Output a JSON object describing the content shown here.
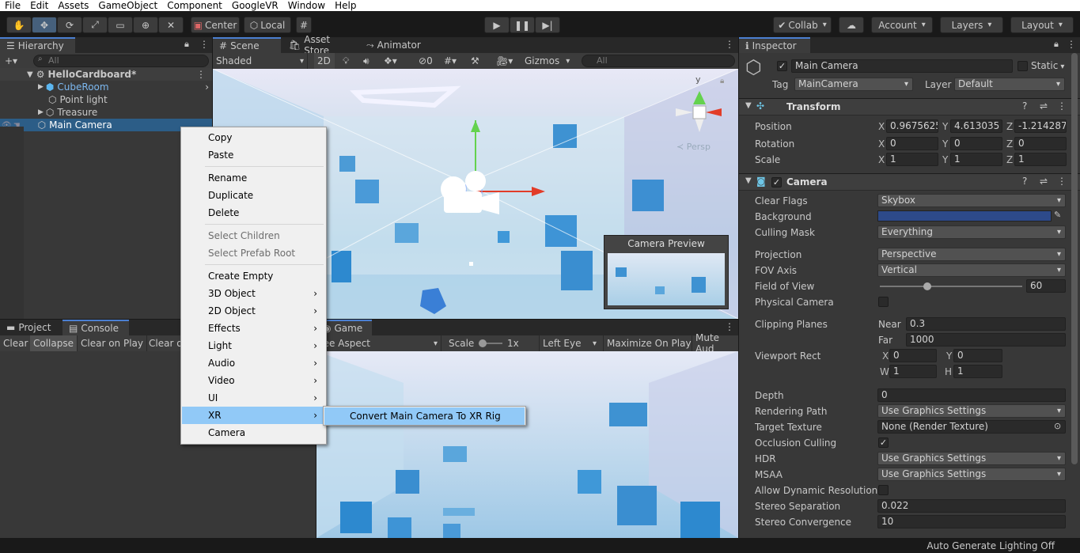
{
  "menubar": [
    "File",
    "Edit",
    "Assets",
    "GameObject",
    "Component",
    "GoogleVR",
    "Window",
    "Help"
  ],
  "toolbar": {
    "pivot_mode": "Center",
    "pivot_space": "Local",
    "collab": "Collab",
    "account": "Account",
    "layers": "Layers",
    "layout": "Layout"
  },
  "hierarchy": {
    "tab": "Hierarchy",
    "search_placeholder": "All",
    "scene": "HelloCardboard*",
    "items": [
      {
        "label": "CubeRoom"
      },
      {
        "label": "Point light"
      },
      {
        "label": "Treasure"
      },
      {
        "label": "Main Camera"
      }
    ]
  },
  "scene_view": {
    "tabs": [
      "Scene",
      "Asset Store",
      "Animator"
    ],
    "shading": "Shaded",
    "mode_2d": "2D",
    "hidden_count": "0",
    "gizmos": "Gizmos",
    "search_placeholder": "All",
    "persp": "Persp",
    "camera_preview": "Camera Preview",
    "axis_y": "y"
  },
  "project": {
    "tabs": [
      "Project",
      "Console"
    ],
    "buttons": [
      "Clear",
      "Collapse",
      "Clear on Play",
      "Clear o"
    ]
  },
  "game_view": {
    "tab": "Game",
    "aspect": "ree Aspect",
    "scale_label": "Scale",
    "scale_value": "1x",
    "eye": "Left Eye",
    "maximize": "Maximize On Play",
    "mute": "Mute Aud"
  },
  "context_menu": {
    "items": [
      {
        "label": "Copy"
      },
      {
        "label": "Paste"
      },
      {
        "label": "Rename"
      },
      {
        "label": "Duplicate"
      },
      {
        "label": "Delete"
      },
      {
        "label": "Select Children"
      },
      {
        "label": "Select Prefab Root"
      },
      {
        "label": "Create Empty"
      },
      {
        "label": "3D Object"
      },
      {
        "label": "2D Object"
      },
      {
        "label": "Effects"
      },
      {
        "label": "Light"
      },
      {
        "label": "Audio"
      },
      {
        "label": "Video"
      },
      {
        "label": "UI"
      },
      {
        "label": "XR"
      },
      {
        "label": "Camera"
      }
    ],
    "submenu_item": "Convert Main Camera To XR Rig"
  },
  "inspector": {
    "tab": "Inspector",
    "object_name": "Main Camera",
    "static": "Static",
    "tag_label": "Tag",
    "tag": "MainCamera",
    "layer_label": "Layer",
    "layer": "Default",
    "transform": {
      "title": "Transform",
      "position_label": "Position",
      "rotation_label": "Rotation",
      "scale_label": "Scale",
      "position": {
        "x": "0.9675625",
        "y": "4.613035",
        "z": "-1.214287"
      },
      "rotation": {
        "x": "0",
        "y": "0",
        "z": "0"
      },
      "scale": {
        "x": "1",
        "y": "1",
        "z": "1"
      }
    },
    "camera": {
      "title": "Camera",
      "clear_flags_label": "Clear Flags",
      "clear_flags": "Skybox",
      "background_label": "Background",
      "background_color": "#2d4a8a",
      "culling_mask_label": "Culling Mask",
      "culling_mask": "Everything",
      "projection_label": "Projection",
      "projection": "Perspective",
      "fov_axis_label": "FOV Axis",
      "fov_axis": "Vertical",
      "fov_label": "Field of View",
      "fov": "60",
      "physical_label": "Physical Camera",
      "clipping_label": "Clipping Planes",
      "near_label": "Near",
      "near": "0.3",
      "far_label": "Far",
      "far": "1000",
      "viewport_label": "Viewport Rect",
      "vp_x": "0",
      "vp_y": "0",
      "vp_w": "1",
      "vp_h": "1",
      "depth_label": "Depth",
      "depth": "0",
      "rendering_path_label": "Rendering Path",
      "rendering_path": "Use Graphics Settings",
      "target_texture_label": "Target Texture",
      "target_texture": "None (Render Texture)",
      "occlusion_label": "Occlusion Culling",
      "hdr_label": "HDR",
      "hdr": "Use Graphics Settings",
      "msaa_label": "MSAA",
      "msaa": "Use Graphics Settings",
      "dyn_res_label": "Allow Dynamic Resolution",
      "stereo_sep_label": "Stereo Separation",
      "stereo_sep": "0.022",
      "stereo_conv_label": "Stereo Convergence",
      "stereo_conv": "10"
    }
  },
  "status": "Auto Generate Lighting Off"
}
